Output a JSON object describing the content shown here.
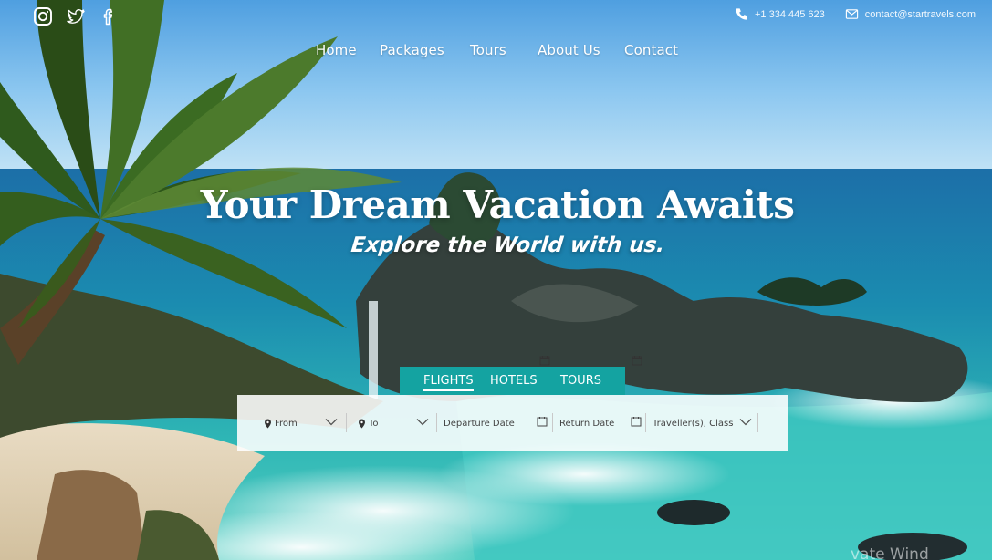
{
  "social": {
    "instagram": "instagram-icon",
    "twitter": "twitter-icon",
    "facebook": "facebook-icon"
  },
  "contact": {
    "phone": "+1 334 445 623",
    "email": "contact@startravels.com"
  },
  "nav": {
    "items": [
      {
        "label": "Home"
      },
      {
        "label": "Packages"
      },
      {
        "label": "Tours"
      },
      {
        "label": "About Us"
      },
      {
        "label": "Contact"
      }
    ]
  },
  "hero": {
    "title": "Your Dream Vacation Awaits",
    "subtitle": "Explore the World with us."
  },
  "search": {
    "tabs": [
      {
        "label": "FLIGHTS",
        "active": true
      },
      {
        "label": "HOTELS",
        "active": false
      },
      {
        "label": "TOURS",
        "active": false
      }
    ],
    "from_placeholder": "From",
    "to_placeholder": "To",
    "departure_placeholder": "Departure Date",
    "return_placeholder": "Return Date",
    "travellers_placeholder": "Traveller(s), Class"
  },
  "watermark": "vate Wind",
  "colors": {
    "accent": "#14a3a1",
    "text_on_dark": "#ffffff"
  }
}
